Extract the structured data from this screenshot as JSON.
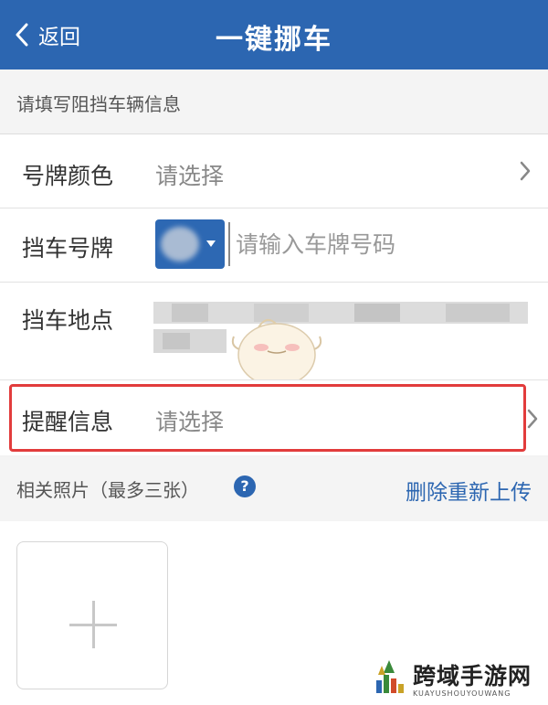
{
  "header": {
    "back_label": "返回",
    "title": "一键挪车",
    "bg_color": "#2c66b1"
  },
  "form": {
    "hint": "请填写阻挡车辆信息",
    "plate_color": {
      "label": "号牌颜色",
      "value": "请选择"
    },
    "plate_number": {
      "label": "挡车号牌",
      "placeholder": "请输入车牌号码"
    },
    "location": {
      "label": "挡车地点"
    },
    "reminder": {
      "label": "提醒信息",
      "value": "请选择"
    }
  },
  "photos": {
    "title": "相关照片（最多三张）",
    "help_glyph": "?",
    "delete_label": "删除重新上传"
  },
  "watermark": {
    "name": "跨域手游网",
    "sub": "KUAYUSHOUYOUWANG"
  },
  "colors": {
    "accent": "#2c66b1",
    "highlight": "#e23c3c"
  }
}
